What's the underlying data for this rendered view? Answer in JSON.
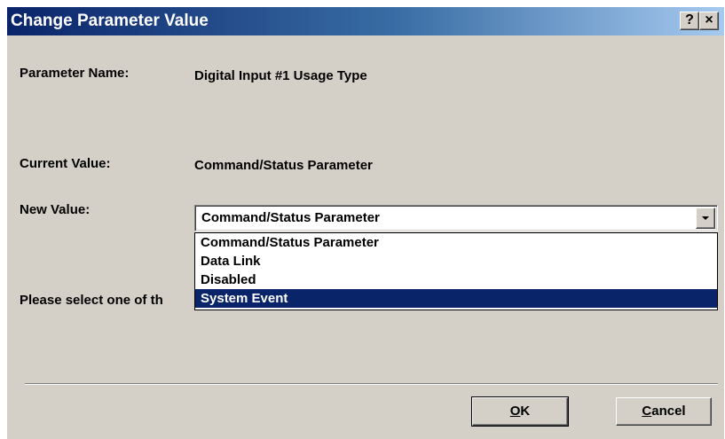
{
  "window": {
    "title": "Change Parameter Value",
    "help_glyph": "?",
    "close_glyph": "×"
  },
  "fields": {
    "parameter_name_label": "Parameter Name:",
    "parameter_name_value": "Digital Input #1 Usage Type",
    "current_value_label": "Current Value:",
    "current_value_value": "Command/Status Parameter",
    "new_value_label": "New Value:",
    "new_value_selected": "Command/Status Parameter",
    "instruction_text": "Please select one of th"
  },
  "dropdown": {
    "options": [
      "Command/Status Parameter",
      "Data Link",
      "Disabled",
      "System Event"
    ],
    "highlighted_index": 3
  },
  "buttons": {
    "ok": {
      "mnemonic": "O",
      "rest": "K"
    },
    "cancel": {
      "mnemonic": "C",
      "rest": "ancel"
    }
  },
  "colors": {
    "titlebar_start": "#0a246a",
    "titlebar_end": "#a6caf0",
    "dialog_face": "#d4d0c8",
    "selection": "#0a246a"
  }
}
